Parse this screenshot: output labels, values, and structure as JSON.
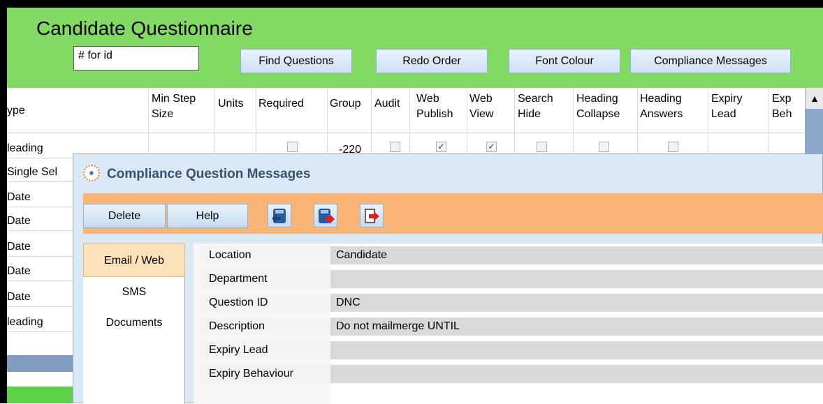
{
  "header": {
    "title": "Candidate Questionnaire",
    "id_input_value": "# for id",
    "buttons": [
      "Find Questions",
      "Redo Order",
      "Font Colour",
      "Compliance Messages"
    ],
    "bg_color": "#82da64"
  },
  "grid": {
    "headers": {
      "type": "ype",
      "min_step": "Min Step",
      "min_step_2": "Size",
      "units": "Units",
      "required": "Required",
      "group": "Group",
      "audit": "Audit",
      "web_publish": "Web",
      "web_publish_2": "Publish",
      "web_view": "Web",
      "web_view_2": "View",
      "search_hide": "Search",
      "search_hide_2": "Hide",
      "heading_collapse": "Heading",
      "heading_collapse_2": "Collapse",
      "heading_answers": "Heading",
      "heading_answers_2": "Answers",
      "expiry_lead": "Expiry",
      "expiry_lead_2": "Lead",
      "exp_beh": "Exp",
      "exp_beh_2": "Beh"
    },
    "row1": {
      "group": "-220",
      "web_publish_checked": true,
      "web_view_checked": true
    },
    "row_types": [
      "leading",
      "Single Sel",
      "Date",
      "Date",
      "Date",
      "Date",
      "Date",
      "leading"
    ]
  },
  "dialog": {
    "title": "Compliance Question Messages",
    "toolbar": {
      "delete": "Delete",
      "help": "Help",
      "icons": [
        "save-icon",
        "refresh-icon",
        "exit-icon"
      ]
    },
    "toolbar_color": "#f9b476",
    "sidebar": [
      "Email / Web",
      "SMS",
      "Documents"
    ],
    "selected_tab": "Email / Web",
    "fields": [
      {
        "label": "Location",
        "value": "Candidate"
      },
      {
        "label": "Department",
        "value": ""
      },
      {
        "label": "Question ID",
        "value": "DNC"
      },
      {
        "label": "Description",
        "value": "Do not mailmerge UNTIL"
      },
      {
        "label": "Expiry Lead",
        "value": ""
      },
      {
        "label": "Expiry Behaviour",
        "value": ""
      }
    ]
  }
}
